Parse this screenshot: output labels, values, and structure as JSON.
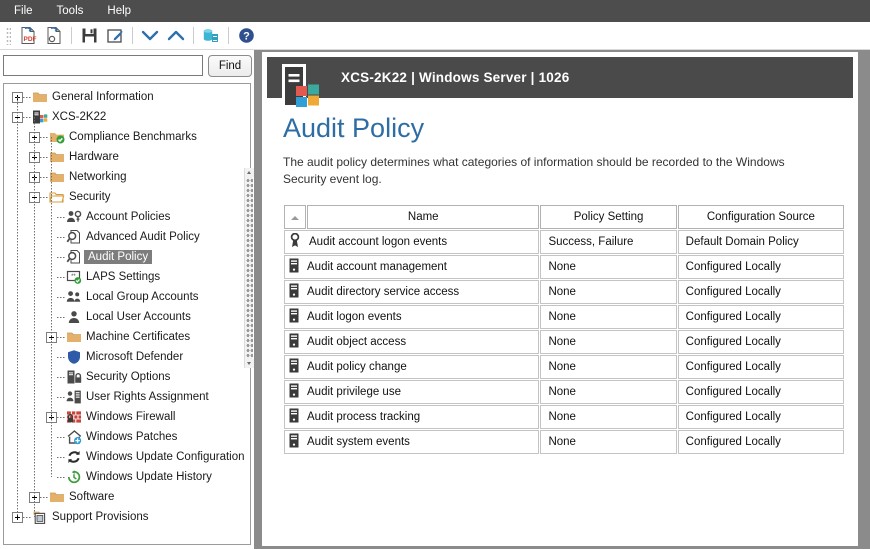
{
  "menubar": {
    "items": [
      {
        "label": "File",
        "name": "menu-file"
      },
      {
        "label": "Tools",
        "name": "menu-tools"
      },
      {
        "label": "Help",
        "name": "menu-help"
      }
    ]
  },
  "toolbar": {
    "buttons": [
      {
        "icon": "export-pdf-icon",
        "title": "Export to PDF"
      },
      {
        "icon": "export-pdf-settings-icon",
        "title": "PDF Options"
      },
      {
        "icon": "save-icon",
        "title": "Save"
      },
      {
        "icon": "edit-note-icon",
        "title": "Edit Note"
      },
      {
        "icon": "chevron-down-icon",
        "title": "Expand"
      },
      {
        "icon": "chevron-up-icon",
        "title": "Collapse"
      },
      {
        "icon": "database-refresh-icon",
        "title": "Refresh Data"
      },
      {
        "icon": "help-icon",
        "title": "Help"
      }
    ]
  },
  "search": {
    "value": "",
    "placeholder": "",
    "find_label": "Find"
  },
  "tree": {
    "items": [
      {
        "label": "General Information",
        "icon": "folder-icon",
        "depth": 0,
        "toggle": "plus",
        "selected": false
      },
      {
        "label": "XCS-2K22",
        "icon": "server-windows-icon",
        "depth": 0,
        "toggle": "minus",
        "selected": false
      },
      {
        "label": "Compliance Benchmarks",
        "icon": "folder-check-icon",
        "depth": 1,
        "toggle": "plus",
        "selected": false
      },
      {
        "label": "Hardware",
        "icon": "folder-icon",
        "depth": 1,
        "toggle": "plus",
        "selected": false
      },
      {
        "label": "Networking",
        "icon": "folder-icon",
        "depth": 1,
        "toggle": "plus",
        "selected": false
      },
      {
        "label": "Security",
        "icon": "folder-open-icon",
        "depth": 1,
        "toggle": "minus",
        "selected": false
      },
      {
        "label": "Account Policies",
        "icon": "account-policies-icon",
        "depth": 2,
        "toggle": "none",
        "selected": false
      },
      {
        "label": "Advanced Audit Policy",
        "icon": "magnifier-doc-icon",
        "depth": 2,
        "toggle": "none",
        "selected": false
      },
      {
        "label": "Audit Policy",
        "icon": "magnifier-doc-icon",
        "depth": 2,
        "toggle": "none",
        "selected": true
      },
      {
        "label": "LAPS Settings",
        "icon": "laps-check-icon",
        "depth": 2,
        "toggle": "none",
        "selected": false
      },
      {
        "label": "Local Group Accounts",
        "icon": "group-icon",
        "depth": 2,
        "toggle": "none",
        "selected": false
      },
      {
        "label": "Local User Accounts",
        "icon": "user-icon",
        "depth": 2,
        "toggle": "none",
        "selected": false
      },
      {
        "label": "Machine Certificates",
        "icon": "folder-icon",
        "depth": 2,
        "toggle": "plus",
        "selected": false
      },
      {
        "label": "Microsoft Defender",
        "icon": "shield-icon",
        "depth": 2,
        "toggle": "none",
        "selected": false
      },
      {
        "label": "Security Options",
        "icon": "server-lock-icon",
        "depth": 2,
        "toggle": "none",
        "selected": false
      },
      {
        "label": "User Rights Assignment",
        "icon": "user-rights-icon",
        "depth": 2,
        "toggle": "none",
        "selected": false
      },
      {
        "label": "Windows Firewall",
        "icon": "firewall-icon",
        "depth": 2,
        "toggle": "plus",
        "selected": false
      },
      {
        "label": "Windows Patches",
        "icon": "patches-icon",
        "depth": 2,
        "toggle": "none",
        "selected": false
      },
      {
        "label": "Windows Update Configuration",
        "icon": "update-config-icon",
        "depth": 2,
        "toggle": "none",
        "selected": false
      },
      {
        "label": "Windows Update History",
        "icon": "update-history-icon",
        "depth": 2,
        "toggle": "none",
        "selected": false
      },
      {
        "label": "Software",
        "icon": "folder-icon",
        "depth": 1,
        "toggle": "plus",
        "selected": false
      },
      {
        "label": "Support Provisions",
        "icon": "support-icon",
        "depth": 0,
        "toggle": "plus",
        "selected": false
      }
    ]
  },
  "panel": {
    "header_title": "XCS-2K22 | Windows Server | 1026",
    "header_icon": "server-windows-logo-icon",
    "title": "Audit Policy",
    "description": "The audit policy determines what categories of information should be recorded to the Windows Security event log."
  },
  "table": {
    "sort_indicator": "sort-asc-icon",
    "columns": [
      "Name",
      "Policy Setting",
      "Configuration Source"
    ],
    "rows": [
      {
        "icon": "key-badge-icon",
        "name": "Audit account logon events",
        "policy": "Success, Failure",
        "source": "Default Domain Policy"
      },
      {
        "icon": "server-tower-icon",
        "name": "Audit account management",
        "policy": "None",
        "source": "Configured Locally"
      },
      {
        "icon": "server-tower-icon",
        "name": "Audit directory service access",
        "policy": "None",
        "source": "Configured Locally"
      },
      {
        "icon": "server-tower-icon",
        "name": "Audit logon events",
        "policy": "None",
        "source": "Configured Locally"
      },
      {
        "icon": "server-tower-icon",
        "name": "Audit object access",
        "policy": "None",
        "source": "Configured Locally"
      },
      {
        "icon": "server-tower-icon",
        "name": "Audit policy change",
        "policy": "None",
        "source": "Configured Locally"
      },
      {
        "icon": "server-tower-icon",
        "name": "Audit privilege use",
        "policy": "None",
        "source": "Configured Locally"
      },
      {
        "icon": "server-tower-icon",
        "name": "Audit process tracking",
        "policy": "None",
        "source": "Configured Locally"
      },
      {
        "icon": "server-tower-icon",
        "name": "Audit system events",
        "policy": "None",
        "source": "Configured Locally"
      }
    ]
  },
  "colors": {
    "menubar_bg": "#4d4d4d",
    "panel_header_bg": "#4a4a4a",
    "app_bg": "#8b8b8b",
    "title_blue": "#2e6da4",
    "selection_gray": "#7d7d7d",
    "folder": "#e8b96a"
  }
}
